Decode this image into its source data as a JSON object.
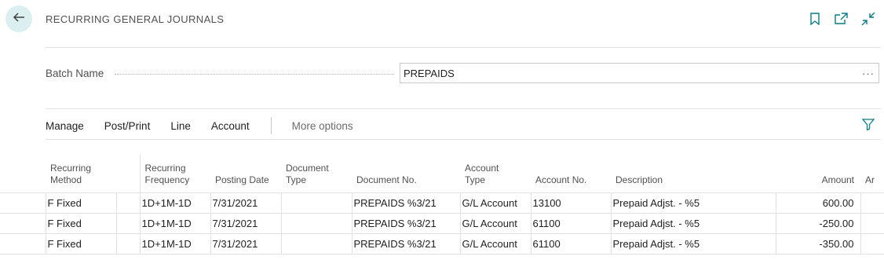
{
  "header": {
    "title": "RECURRING GENERAL JOURNALS"
  },
  "icons": {
    "back": "arrow-left-icon",
    "bookmark": "bookmark-icon",
    "open_new_window": "open-new-window-icon",
    "collapse": "collapse-icon",
    "filter": "filter-icon"
  },
  "batch": {
    "label": "Batch Name",
    "value": "PREPAIDS",
    "more": "···"
  },
  "actions": {
    "items": [
      "Manage",
      "Post/Print",
      "Line",
      "Account"
    ],
    "more_options": "More options"
  },
  "grid": {
    "columns": {
      "recurring_method": [
        "Recurring",
        "Method"
      ],
      "recurring_frequency": [
        "Recurring",
        "Frequency"
      ],
      "posting_date": "Posting Date",
      "document_type": [
        "Document",
        "Type"
      ],
      "document_no": "Document No.",
      "account_type": [
        "Account",
        "Type"
      ],
      "account_no": "Account No.",
      "description": "Description",
      "amount": "Amount",
      "truncated": "Ar"
    },
    "rows": [
      {
        "method": "F  Fixed",
        "frequency": "1D+1M-1D",
        "posting_date": "7/31/2021",
        "document_type": "",
        "document_no": "PREPAIDS %3/21",
        "account_type": "G/L Account",
        "account_no": "13100",
        "description": "Prepaid Adjst. - %5",
        "amount": "600.00"
      },
      {
        "method": "F  Fixed",
        "frequency": "1D+1M-1D",
        "posting_date": "7/31/2021",
        "document_type": "",
        "document_no": "PREPAIDS %3/21",
        "account_type": "G/L Account",
        "account_no": "61100",
        "description": "Prepaid Adjst. - %5",
        "amount": "-250.00"
      },
      {
        "method": "F  Fixed",
        "frequency": "1D+1M-1D",
        "posting_date": "7/31/2021",
        "document_type": "",
        "document_no": "PREPAIDS %3/21",
        "account_type": "G/L Account",
        "account_no": "61100",
        "description": "Prepaid Adjst. - %5",
        "amount": "-350.00"
      }
    ]
  },
  "colors": {
    "accent": "#0a7c86",
    "back_bg": "#dbeef0"
  }
}
